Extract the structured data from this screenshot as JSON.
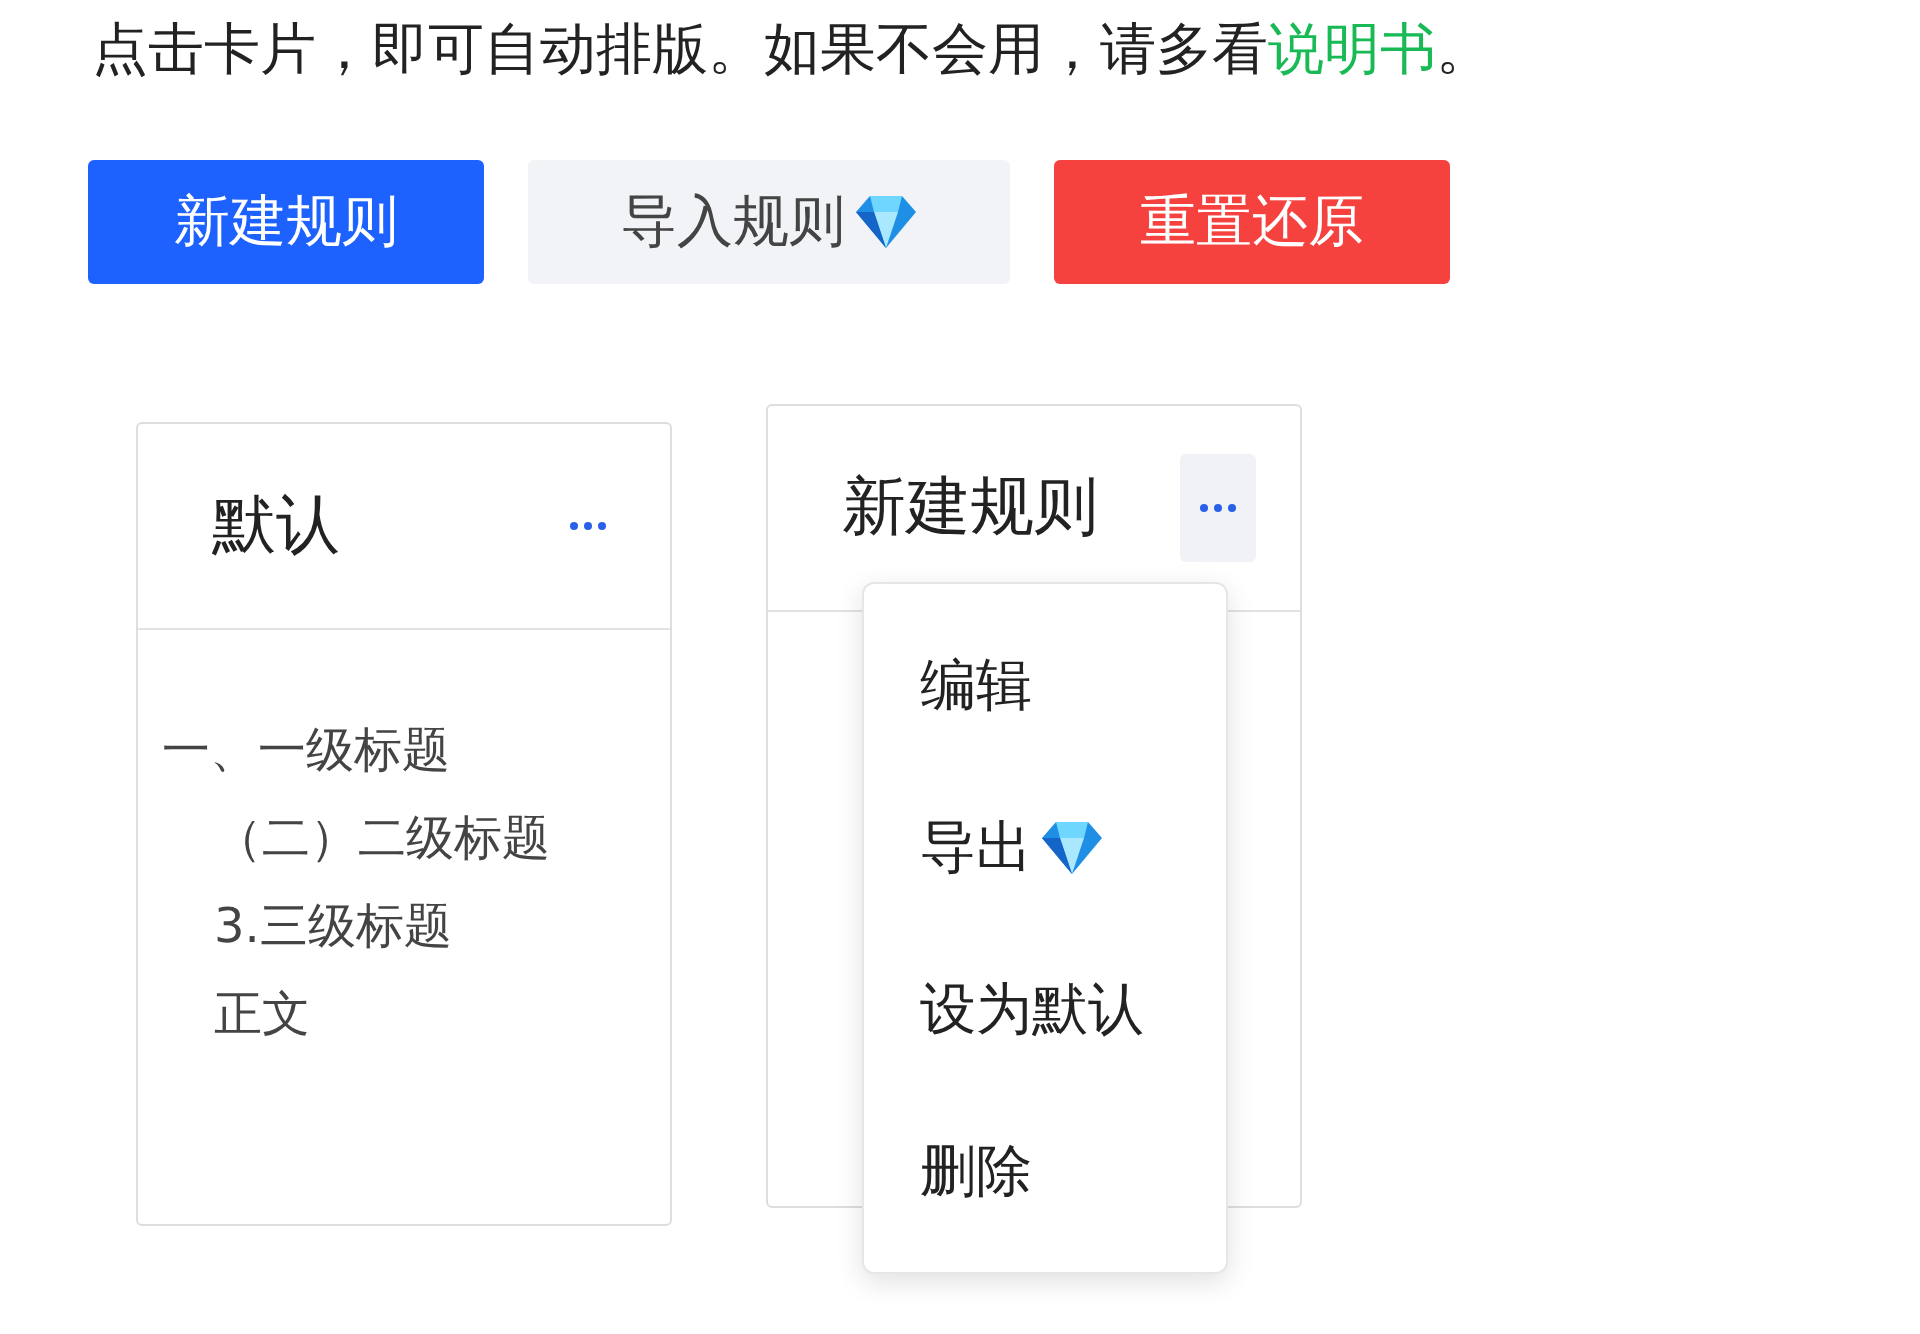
{
  "intro": {
    "text": "点击卡片，即可自动排版。如果不会用，请多看",
    "link": "说明书",
    "end": "。"
  },
  "buttons": [
    {
      "label": "新建规则",
      "kind": "primary",
      "premium": false
    },
    {
      "label": "导入规则",
      "kind": "secondary",
      "premium": true
    },
    {
      "label": "重置还原",
      "kind": "danger",
      "premium": false
    }
  ],
  "cards": [
    {
      "title": "默认",
      "menu_open": false,
      "lines": [
        {
          "text": "一、一级标题",
          "kind": "h1"
        },
        {
          "text": "（二）二级标题",
          "kind": "h2"
        },
        {
          "text": "3.三级标题",
          "kind": "h3"
        },
        {
          "text": "正文",
          "kind": "body"
        }
      ]
    },
    {
      "title": "新建规则",
      "menu_open": true,
      "menu": [
        {
          "label": "编辑",
          "premium": false
        },
        {
          "label": "导出",
          "premium": true
        },
        {
          "label": "设为默认",
          "premium": false
        },
        {
          "label": "删除",
          "premium": false
        }
      ]
    }
  ]
}
